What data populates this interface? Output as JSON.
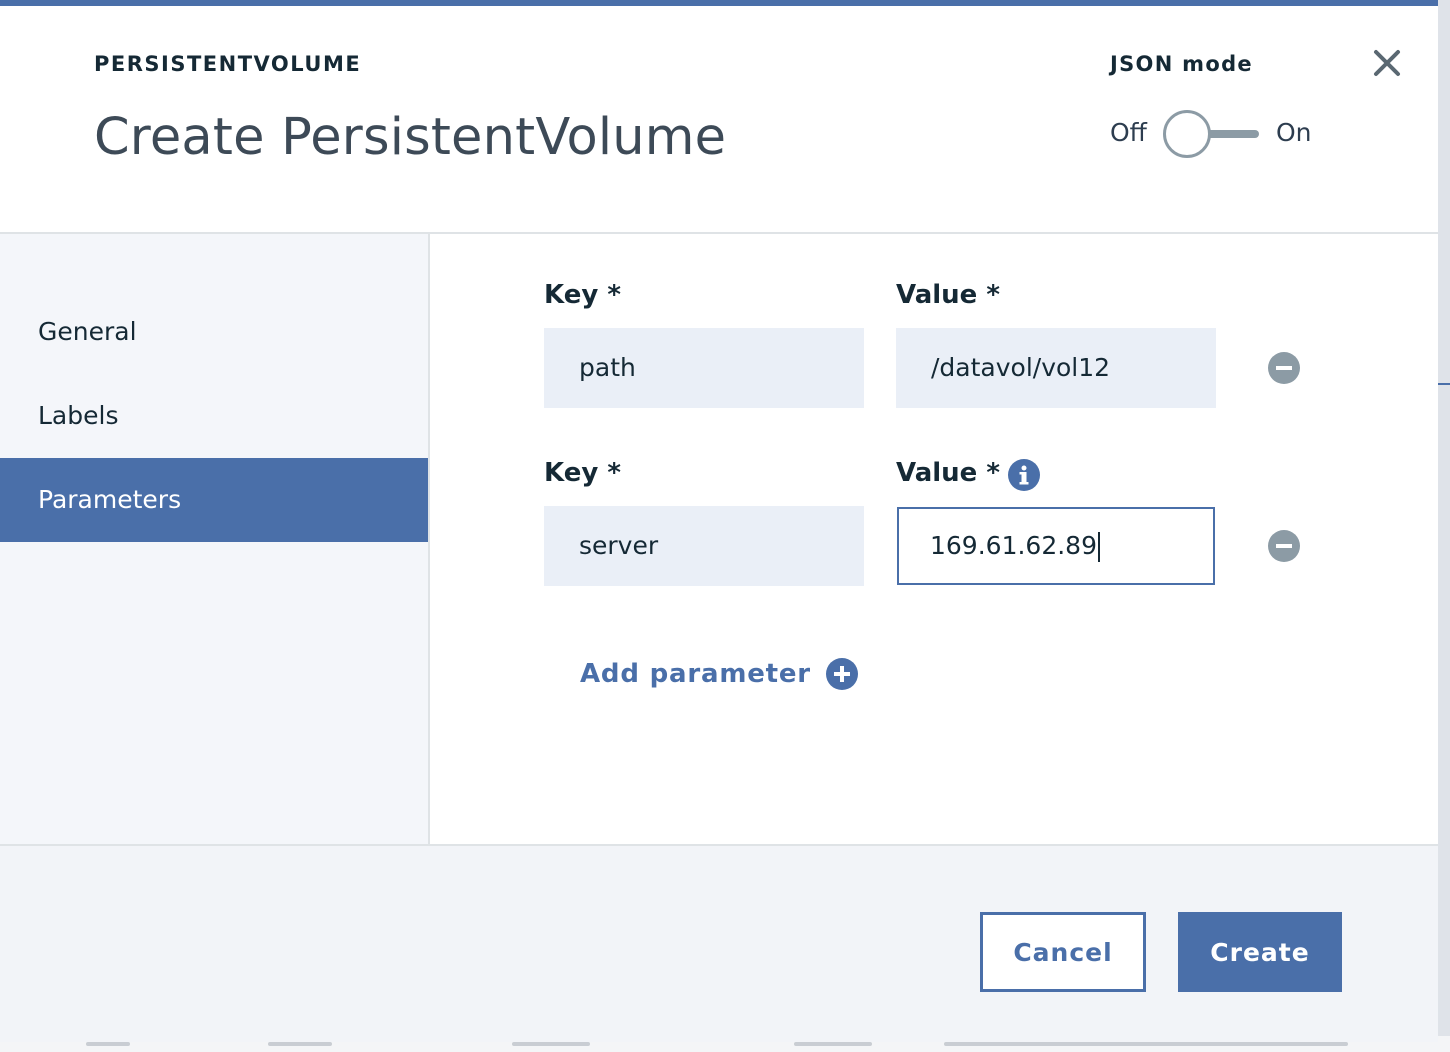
{
  "header": {
    "eyebrow": "PERSISTENTVOLUME",
    "title": "Create PersistentVolume",
    "json_mode": {
      "label": "JSON mode",
      "off_label": "Off",
      "on_label": "On",
      "state": "off"
    },
    "close_icon": "close-icon"
  },
  "sidebar": {
    "items": [
      {
        "label": "General",
        "active": false
      },
      {
        "label": "Labels",
        "active": false
      },
      {
        "label": "Parameters",
        "active": true
      }
    ]
  },
  "parameters": {
    "rows": [
      {
        "key_label": "Key *",
        "value_label": "Value *",
        "key": "path",
        "value": "/datavol/vol12",
        "has_info": false
      },
      {
        "key_label": "Key *",
        "value_label": "Value *",
        "key": "server",
        "value": "169.61.62.89",
        "has_info": true
      }
    ],
    "add_label": "Add parameter"
  },
  "footer": {
    "cancel_label": "Cancel",
    "create_label": "Create"
  },
  "colors": {
    "accent": "#4a6fa9",
    "text": "#152935",
    "field_bg": "#eaeff7",
    "sidebar_bg": "#f4f6fa",
    "icon_gray": "#8c9ba5"
  }
}
